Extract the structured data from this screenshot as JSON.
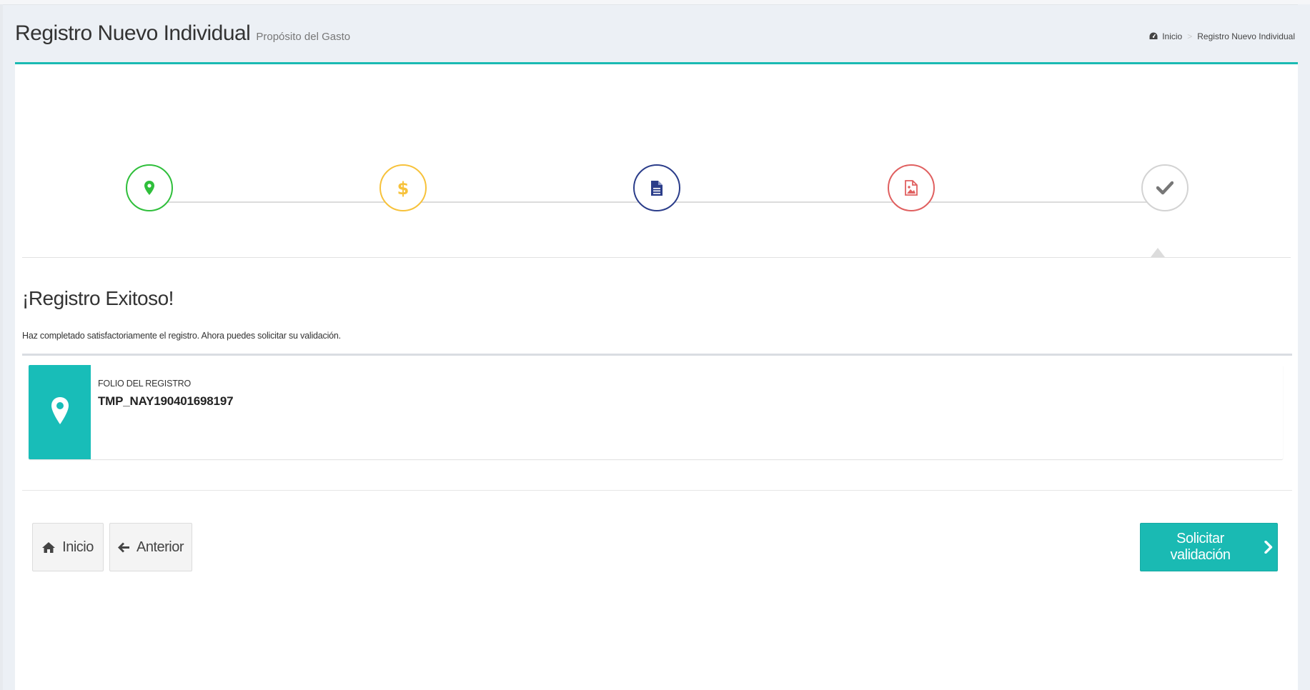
{
  "header": {
    "title": "Registro Nuevo Individual",
    "subtitle": "Propósito del Gasto"
  },
  "breadcrumb": {
    "home_icon": "dashboard-icon",
    "home_label": "Inicio",
    "separator": ">",
    "current_label": "Registro Nuevo Individual"
  },
  "wizard": {
    "steps": [
      {
        "icon": "map-marker-icon",
        "color": "#2fbf3b"
      },
      {
        "icon": "dollar-icon",
        "color": "#f7c23b"
      },
      {
        "icon": "file-icon",
        "color": "#2b3d8a"
      },
      {
        "icon": "image-file-icon",
        "color": "#e06060"
      },
      {
        "icon": "check-icon",
        "color": "#777777"
      }
    ],
    "active_step": 5
  },
  "result": {
    "title": "¡Registro Exitoso!",
    "message": "Haz completado satisfactoriamente el registro. Ahora puedes solicitar su validación."
  },
  "info_box": {
    "icon": "map-marker-icon",
    "label": "FOLIO DEL REGISTRO",
    "value": "TMP_NAY190401698197"
  },
  "actions": {
    "home_label": "Inicio",
    "home_icon": "home-icon",
    "prev_label": "Anterior",
    "prev_icon": "arrow-left-icon",
    "submit_label": "Solicitar validación",
    "submit_icon": "chevron-right-icon"
  },
  "colors": {
    "accent": "#1abab3",
    "background": "#ecf0f5"
  }
}
